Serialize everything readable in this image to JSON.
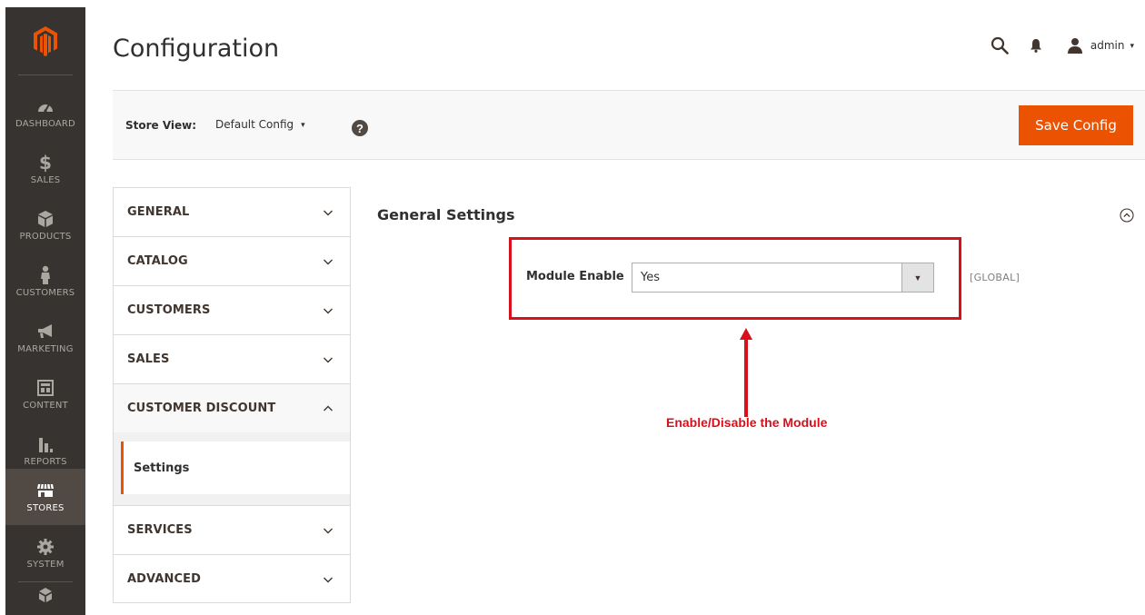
{
  "sidebar": {
    "items": [
      {
        "label": "DASHBOARD",
        "icon": "dashboard-icon"
      },
      {
        "label": "SALES",
        "icon": "dollar-icon"
      },
      {
        "label": "PRODUCTS",
        "icon": "box-icon"
      },
      {
        "label": "CUSTOMERS",
        "icon": "person-icon"
      },
      {
        "label": "MARKETING",
        "icon": "megaphone-icon"
      },
      {
        "label": "CONTENT",
        "icon": "layout-icon"
      },
      {
        "label": "REPORTS",
        "icon": "bar-chart-icon"
      },
      {
        "label": "STORES",
        "icon": "storefront-icon"
      },
      {
        "label": "SYSTEM",
        "icon": "gear-icon"
      }
    ],
    "active": "STORES",
    "colors": {
      "bg": "#373330",
      "active_bg": "#514943",
      "logo": "#eb5202"
    }
  },
  "header": {
    "title": "Configuration",
    "user": "admin",
    "caret": "▾"
  },
  "store_bar": {
    "label": "Store View:",
    "value": "Default Config",
    "caret": "▾",
    "help": "?",
    "save_label": "Save Config",
    "save_color": "#eb5202"
  },
  "tabs": {
    "items": [
      {
        "label": "GENERAL"
      },
      {
        "label": "CATALOG"
      },
      {
        "label": "CUSTOMERS"
      },
      {
        "label": "SALES"
      },
      {
        "label": "CUSTOMER DISCOUNT",
        "open": true,
        "subitems": [
          "Settings"
        ]
      },
      {
        "label": "SERVICES"
      },
      {
        "label": "ADVANCED"
      }
    ]
  },
  "content": {
    "section_title": "General Settings",
    "field": {
      "label": "Module Enable",
      "value": "Yes",
      "arrow": "▼",
      "scope": "[GLOBAL]"
    }
  },
  "annotation": {
    "text": "Enable/Disable the Module",
    "color": "#d7101c"
  }
}
